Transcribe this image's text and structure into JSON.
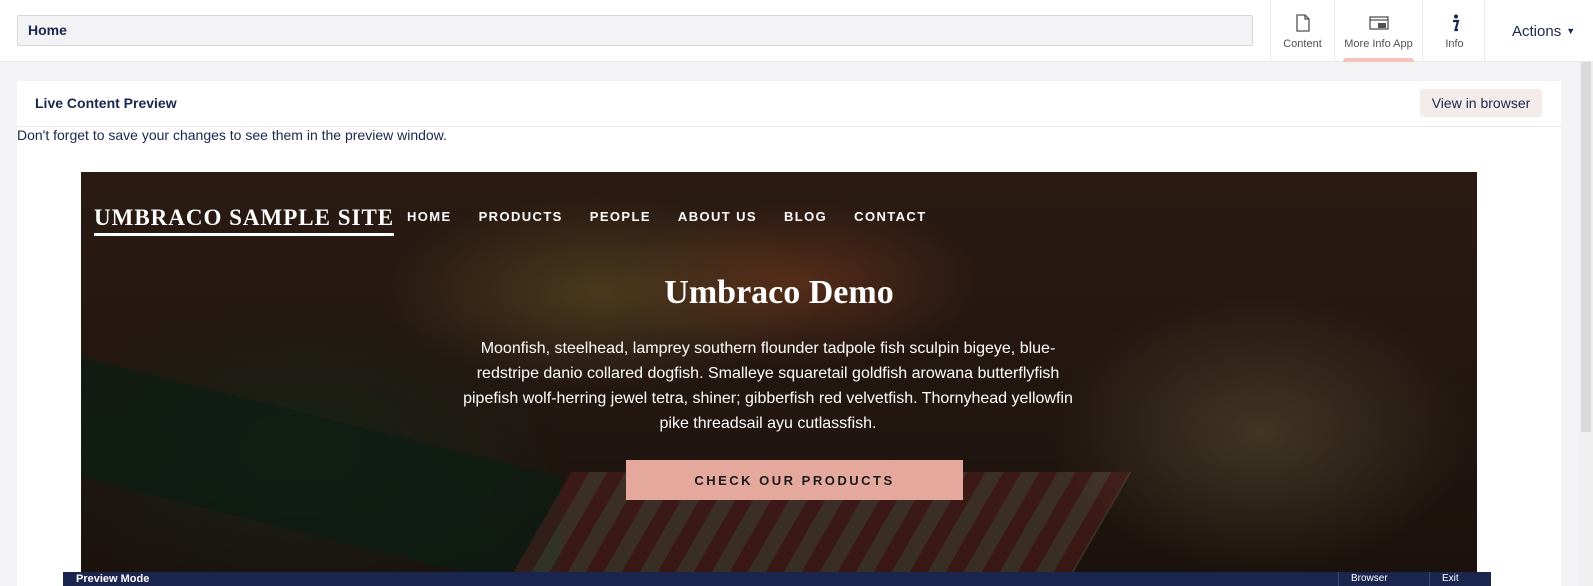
{
  "header": {
    "name_value": "Home",
    "apps": [
      {
        "label": "Content",
        "icon": "document-icon"
      },
      {
        "label": "More Info App",
        "icon": "window-icon"
      },
      {
        "label": "Info",
        "icon": "info-icon"
      }
    ],
    "actions_label": "Actions"
  },
  "box": {
    "title": "Live Content Preview",
    "view_button": "View in browser",
    "notice": "Don't forget to save your changes to see them in the preview window."
  },
  "site": {
    "logo": "UMBRACO SAMPLE SITE",
    "nav": [
      "HOME",
      "PRODUCTS",
      "PEOPLE",
      "ABOUT US",
      "BLOG",
      "CONTACT"
    ],
    "hero_title": "Umbraco Demo",
    "hero_text": "Moonfish, steelhead, lamprey southern flounder tadpole fish sculpin bigeye, blue-redstripe danio collared dogfish. Smalleye squaretail goldfish arowana butterflyfish pipefish wolf-herring jewel tetra, shiner; gibberfish red velvetfish. Thornyhead yellowfin pike threadsail ayu cutlassfish.",
    "cta": "CHECK OUR PRODUCTS"
  },
  "preview_bar": {
    "label": "Preview Mode",
    "browser": "Browser",
    "exit": "Exit"
  },
  "colors": {
    "brand_navy": "#1b264f",
    "accent_pink": "#f5c1bc",
    "cta_salmon": "#e5a89c"
  }
}
